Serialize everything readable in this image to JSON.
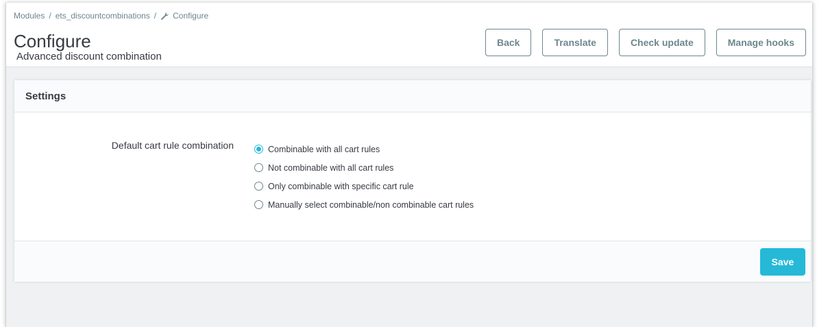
{
  "breadcrumb": {
    "items": [
      "Modules",
      "ets_discountcombinations",
      "Configure"
    ],
    "separator": "/",
    "last_icon": "wrench-icon"
  },
  "header": {
    "title": "Configure",
    "subtitle": "Advanced discount combination"
  },
  "toolbar": {
    "back_label": "Back",
    "translate_label": "Translate",
    "check_update_label": "Check update",
    "manage_hooks_label": "Manage hooks"
  },
  "settings": {
    "title": "Settings",
    "field_label": "Default cart rule combination",
    "options": [
      {
        "label": "Combinable with all cart rules",
        "checked": true
      },
      {
        "label": "Not combinable with all cart rules",
        "checked": false
      },
      {
        "label": "Only combinable with specific cart rule",
        "checked": false
      },
      {
        "label": "Manually select combinable/non combinable cart rules",
        "checked": false
      }
    ],
    "save_label": "Save"
  },
  "colors": {
    "accent": "#25b9d7",
    "muted": "#6c868e",
    "text": "#363a41",
    "background": "#eff1f2"
  }
}
